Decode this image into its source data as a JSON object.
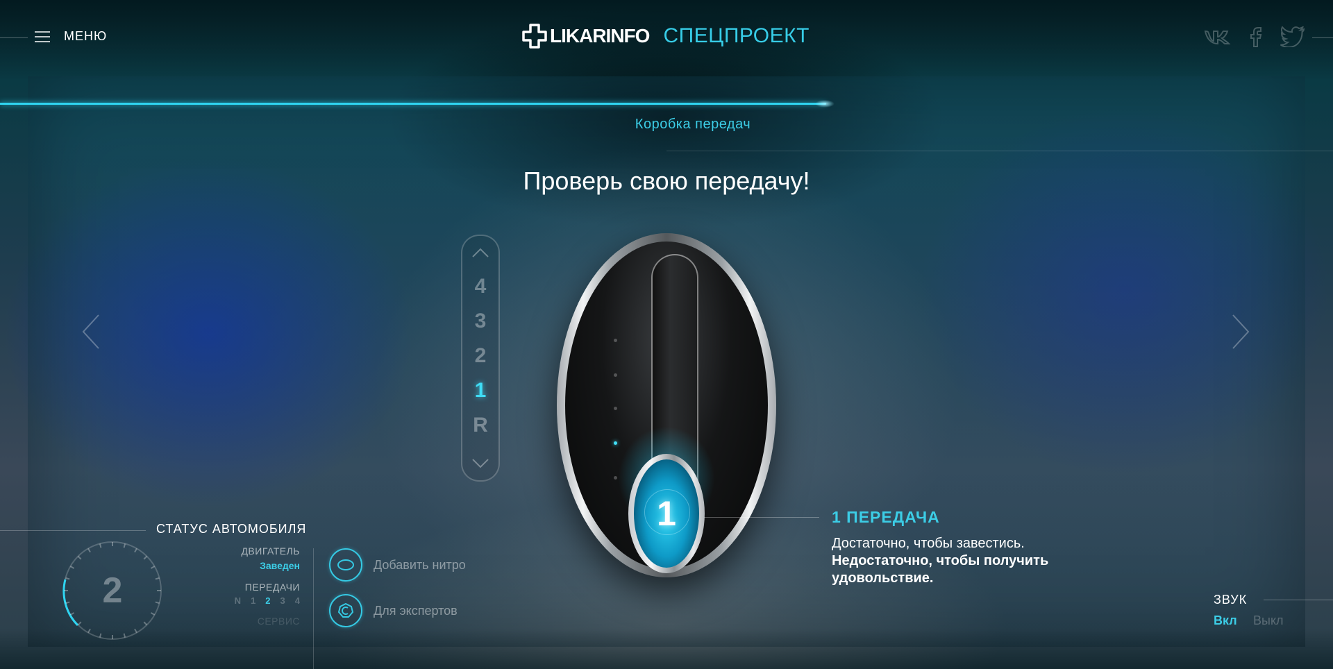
{
  "header": {
    "menu_label": "МЕНЮ",
    "logo_text": "LIKARINFO",
    "logo_sub": "СПЕЦПРОЕКТ",
    "social": [
      "vk-icon",
      "facebook-icon",
      "twitter-icon"
    ]
  },
  "progress": {
    "fraction": 0.62
  },
  "section_title": "Коробка передач",
  "heading": "Проверь свою передачу!",
  "gear_selector": {
    "gears": [
      "4",
      "3",
      "2",
      "1",
      "R"
    ],
    "active": "1"
  },
  "shifter": {
    "current_gear": "1"
  },
  "gear_info": {
    "title": "1 ПЕРЕДАЧА",
    "text": "Достаточно, чтобы завестись.",
    "bold_text": "Недостаточно, чтобы получить удовольствие."
  },
  "status": {
    "title": "СТАТУС АВТОМОБИЛЯ",
    "gauge_value": "2",
    "engine_label": "ДВИГАТЕЛЬ",
    "engine_value": "Заведен",
    "gears_label": "ПЕРЕДАЧИ",
    "gears": [
      "N",
      "1",
      "2",
      "3",
      "4"
    ],
    "current_gear": "2",
    "service_label": "СЕРВИС"
  },
  "actions": {
    "nitro_label": "Добавить нитро",
    "experts_label": "Для экспертов"
  },
  "sound": {
    "title": "ЗВУК",
    "on_label": "Вкл",
    "off_label": "Выкл",
    "state": "on"
  },
  "colors": {
    "accent": "#3ccde6",
    "background": "#0a3a44"
  }
}
